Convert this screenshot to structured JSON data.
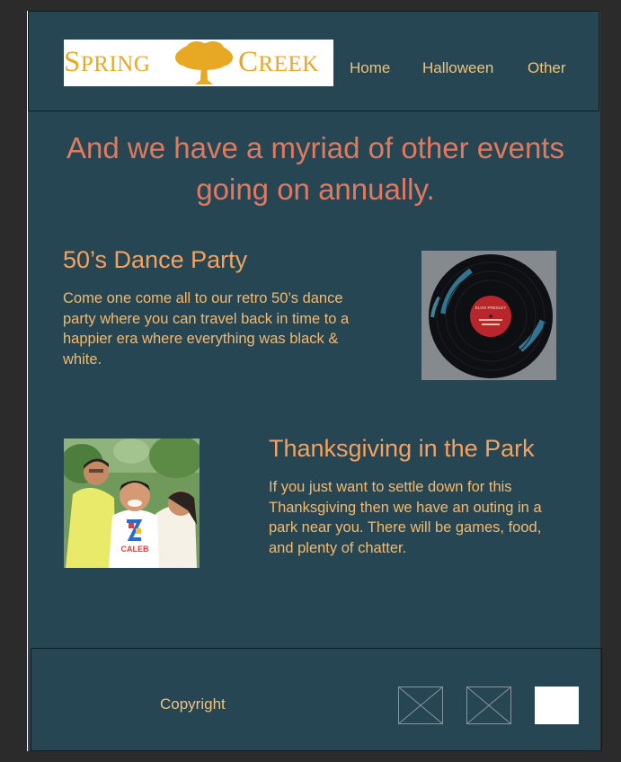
{
  "brand": {
    "word_left": "Spring",
    "word_right": "Creek",
    "color": "#e7a823"
  },
  "nav": {
    "home": "Home",
    "halloween": "Halloween",
    "other": "Other"
  },
  "headline": "And we have a myriad of other events going on annually.",
  "events": [
    {
      "title": "50’s Dance Party",
      "text": "Come one come all to our retro 50’s dance party where you can travel back in time to a happier era where everything was black & white.",
      "image": "vinyl-record-photo"
    },
    {
      "title": "Thanksgiving in the Park",
      "text": "If you just want to settle down for this Thanksgiving then we have an outing in a park near you. There will be games, food, and plenty of chatter.",
      "image": "family-photo"
    }
  ],
  "vinyl_label": "ELVIS PRESLEY",
  "family_shirt": "CALEB",
  "footer": {
    "copyright": "Copyright"
  },
  "colors": {
    "background": "#264653",
    "headline": "#e07a5f",
    "heading": "#f4a261",
    "text": "#f4b96e"
  }
}
